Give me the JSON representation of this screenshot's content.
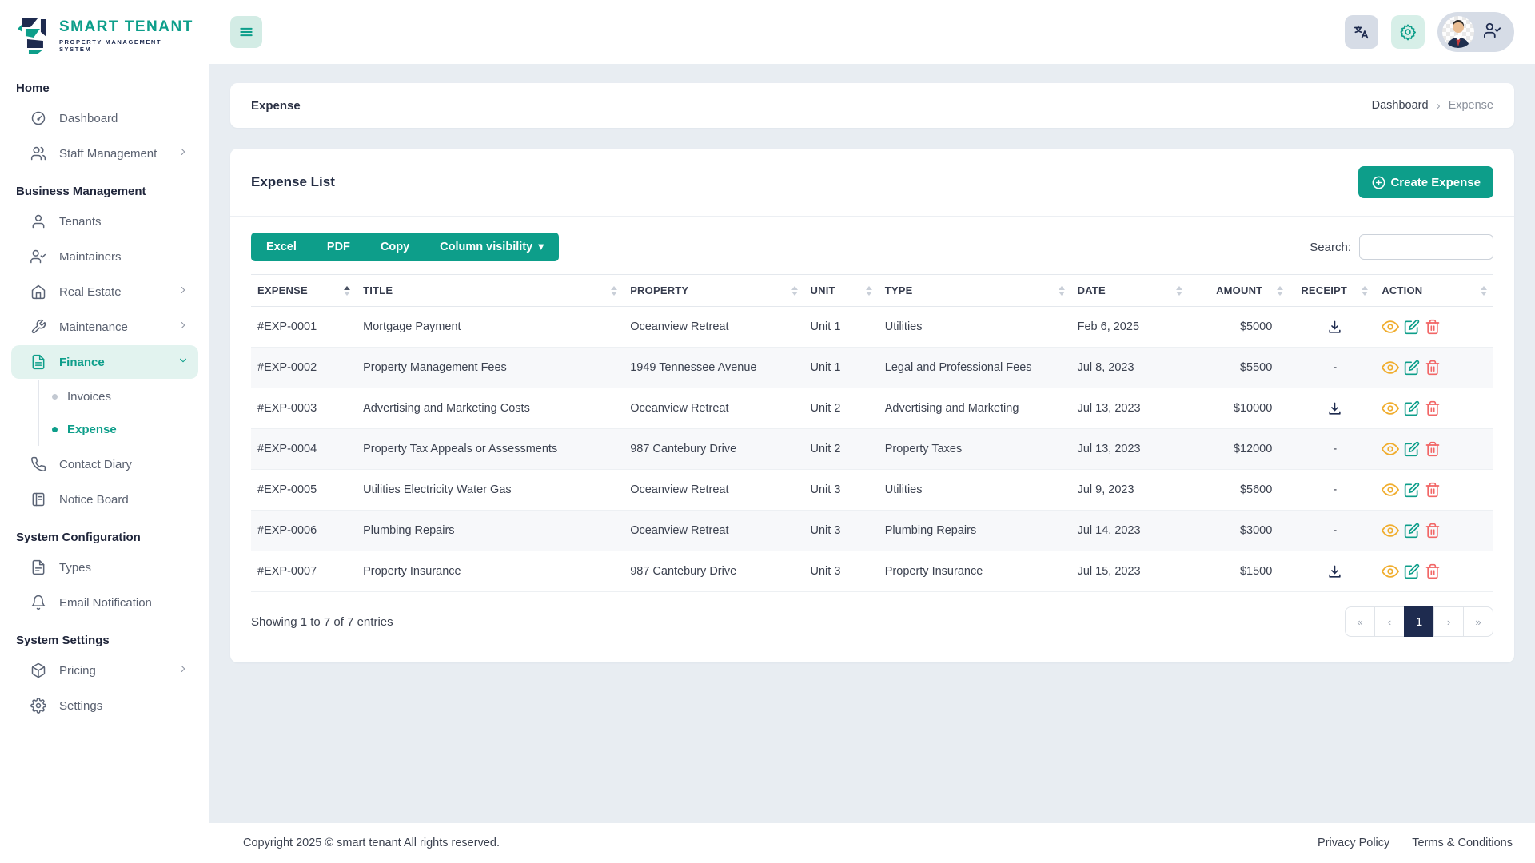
{
  "brand": {
    "name": "SMART TENANT",
    "tagline": "PROPERTY MANAGEMENT SYSTEM"
  },
  "sidebar": {
    "sections": {
      "home": "Home",
      "business": "Business Management",
      "system_configuration": "System Configuration",
      "system_settings": "System Settings"
    },
    "items": {
      "dashboard": "Dashboard",
      "staff_management": "Staff Management",
      "tenants": "Tenants",
      "maintainers": "Maintainers",
      "real_estate": "Real Estate",
      "maintenance": "Maintenance",
      "finance": "Finance",
      "invoices": "Invoices",
      "expense": "Expense",
      "contact_diary": "Contact Diary",
      "notice_board": "Notice Board",
      "types": "Types",
      "email_notification": "Email Notification",
      "pricing": "Pricing",
      "settings": "Settings"
    }
  },
  "page": {
    "title": "Expense",
    "breadcrumb": {
      "parent": "Dashboard",
      "separator": "›",
      "current": "Expense"
    }
  },
  "card": {
    "title": "Expense List",
    "create_button": "Create Expense"
  },
  "toolbar": {
    "excel": "Excel",
    "pdf": "PDF",
    "copy": "Copy",
    "column_visibility": "Column visibility",
    "caret": "▾",
    "search_label": "Search:",
    "search_value": ""
  },
  "table": {
    "headers": [
      "EXPENSE",
      "TITLE",
      "PROPERTY",
      "UNIT",
      "TYPE",
      "DATE",
      "AMOUNT",
      "RECEIPT",
      "ACTION"
    ],
    "rows": [
      {
        "expense": "#EXP-0001",
        "title": "Mortgage Payment",
        "property": "Oceanview Retreat",
        "unit": "Unit 1",
        "type": "Utilities",
        "date": "Feb 6, 2025",
        "amount": "$5000",
        "receipt": "download"
      },
      {
        "expense": "#EXP-0002",
        "title": "Property Management Fees",
        "property": "1949 Tennessee Avenue",
        "unit": "Unit 1",
        "type": "Legal and Professional Fees",
        "date": "Jul 8, 2023",
        "amount": "$5500",
        "receipt": "-"
      },
      {
        "expense": "#EXP-0003",
        "title": "Advertising and Marketing Costs",
        "property": "Oceanview Retreat",
        "unit": "Unit 2",
        "type": "Advertising and Marketing",
        "date": "Jul 13, 2023",
        "amount": "$10000",
        "receipt": "download"
      },
      {
        "expense": "#EXP-0004",
        "title": "Property Tax Appeals or Assessments",
        "property": "987 Cantebury Drive",
        "unit": "Unit 2",
        "type": "Property Taxes",
        "date": "Jul 13, 2023",
        "amount": "$12000",
        "receipt": "-"
      },
      {
        "expense": "#EXP-0005",
        "title": "Utilities Electricity Water Gas",
        "property": "Oceanview Retreat",
        "unit": "Unit 3",
        "type": "Utilities",
        "date": "Jul 9, 2023",
        "amount": "$5600",
        "receipt": "-"
      },
      {
        "expense": "#EXP-0006",
        "title": "Plumbing Repairs",
        "property": "Oceanview Retreat",
        "unit": "Unit 3",
        "type": "Plumbing Repairs",
        "date": "Jul 14, 2023",
        "amount": "$3000",
        "receipt": "-"
      },
      {
        "expense": "#EXP-0007",
        "title": "Property Insurance",
        "property": "987 Cantebury Drive",
        "unit": "Unit 3",
        "type": "Property Insurance",
        "date": "Jul 15, 2023",
        "amount": "$1500",
        "receipt": "download"
      }
    ],
    "summary": "Showing 1 to 7 of 7 entries"
  },
  "pagination": {
    "first": "«",
    "prev": "‹",
    "page": "1",
    "next": "›",
    "last": "»"
  },
  "footer": {
    "copyright": "Copyright 2025 © smart tenant All rights reserved.",
    "privacy": "Privacy Policy",
    "terms": "Terms & Conditions"
  },
  "colors": {
    "teal": "#0d9e8a",
    "navy": "#1e2b4f",
    "amber": "#f0ad2e",
    "red": "#f26666",
    "page_bg": "#e8edf2",
    "active_bg": "#e2f3ef"
  }
}
